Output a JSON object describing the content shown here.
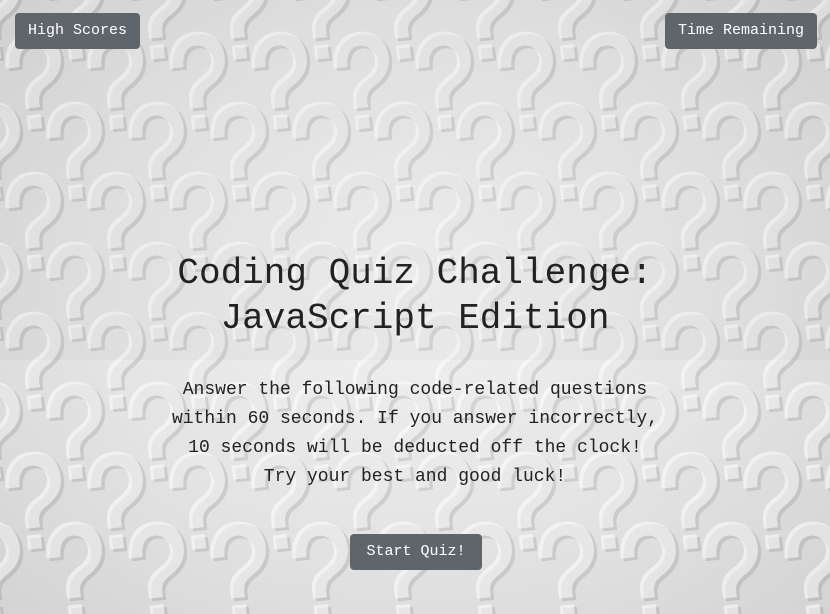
{
  "header": {
    "high_scores_label": "High Scores",
    "time_remaining_label": "Time Remaining"
  },
  "main": {
    "title_line1": "Coding Quiz Challenge:",
    "title_line2": "JavaScript Edition",
    "description_lines": [
      "Answer the following code-related questions",
      "within 60 seconds. If you answer incorrectly,",
      "10 seconds will be deducted off the clock!",
      "Try your best and good luck!"
    ],
    "start_label": "Start Quiz!"
  },
  "background": {
    "pattern_icon": "question-mark-icon",
    "base_color": "#e3e3e3",
    "mark_color": "#ffffff"
  },
  "colors": {
    "button_bg": "#5e656b",
    "button_text": "#ffffff",
    "text": "#222222"
  }
}
